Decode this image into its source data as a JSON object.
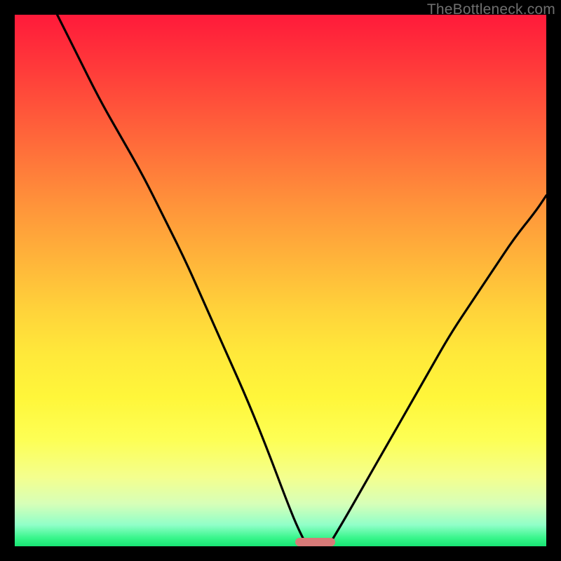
{
  "watermark": "TheBottleneck.com",
  "colors": {
    "frame": "#000000",
    "curve": "#000000",
    "marker": "#d87a78"
  },
  "chart_data": {
    "type": "line",
    "title": "",
    "xlabel": "",
    "ylabel": "",
    "xlim": [
      0,
      100
    ],
    "ylim": [
      0,
      100
    ],
    "series": [
      {
        "name": "left-curve",
        "x": [
          8,
          12,
          16,
          20,
          24,
          28,
          32,
          36,
          40,
          44,
          48,
          51,
          53,
          55
        ],
        "y": [
          100,
          92,
          84,
          77,
          70,
          62,
          54,
          45,
          36,
          27,
          17,
          9,
          4,
          0
        ]
      },
      {
        "name": "right-curve",
        "x": [
          59,
          62,
          66,
          70,
          74,
          78,
          82,
          86,
          90,
          94,
          98,
          100
        ],
        "y": [
          0,
          5,
          12,
          19,
          26,
          33,
          40,
          46,
          52,
          58,
          63,
          66
        ]
      }
    ],
    "marker": {
      "x_center": 56.5,
      "width_pct": 7.5,
      "height_pct": 1.6
    }
  }
}
